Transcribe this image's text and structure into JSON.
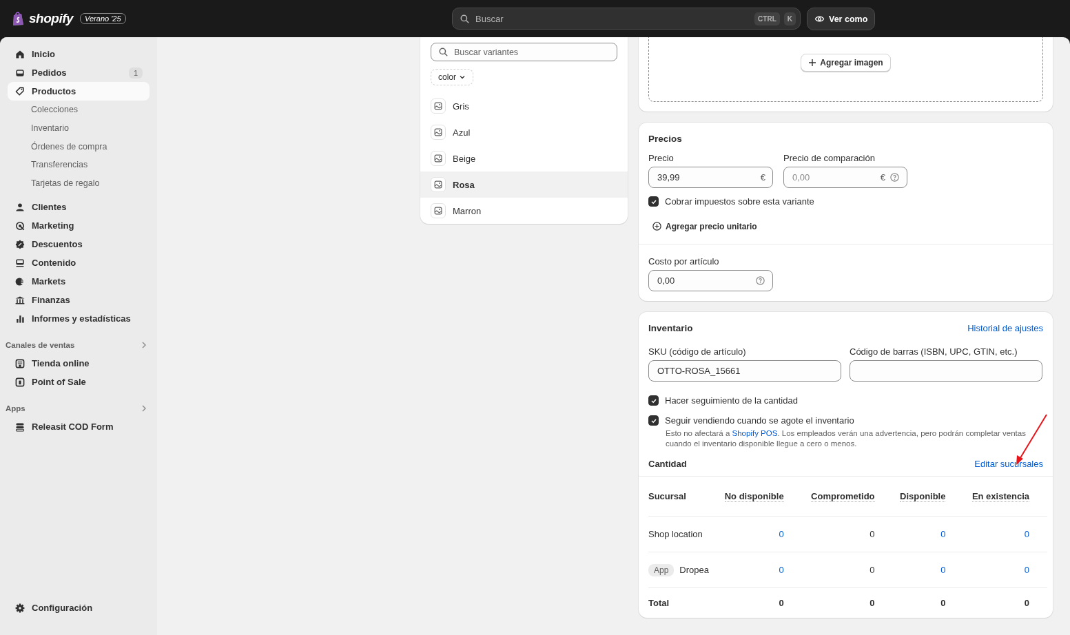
{
  "topbar": {
    "logo": "shopify",
    "edition": "Verano '25",
    "search": {
      "placeholder": "Buscar"
    },
    "shortcut": [
      "CTRL",
      "K"
    ],
    "view_button": "Ver como"
  },
  "sidebar": {
    "items": [
      {
        "label": "Inicio",
        "selected": false
      },
      {
        "label": "Pedidos",
        "selected": false,
        "badge": "1"
      },
      {
        "label": "Productos",
        "selected": true,
        "children": [
          {
            "label": "Colecciones",
            "selected": false
          },
          {
            "label": "Inventario",
            "selected": false
          },
          {
            "label": "Órdenes de compra",
            "selected": false
          },
          {
            "label": "Transferencias",
            "selected": false
          },
          {
            "label": "Tarjetas de regalo",
            "selected": false
          }
        ]
      },
      {
        "label": "Clientes",
        "selected": false
      },
      {
        "label": "Marketing",
        "selected": false
      },
      {
        "label": "Descuentos",
        "selected": false
      },
      {
        "label": "Contenido",
        "selected": false
      },
      {
        "label": "Markets",
        "selected": false
      },
      {
        "label": "Finanzas",
        "selected": false
      },
      {
        "label": "Informes y estadísticas",
        "selected": false
      }
    ],
    "sections": [
      {
        "title": "Canales de ventas",
        "items": [
          {
            "label": "Tienda online",
            "selected": false
          },
          {
            "label": "Point of Sale",
            "selected": false
          }
        ]
      },
      {
        "title": "Apps",
        "items": [
          {
            "label": "Releasit COD Form",
            "selected": false
          }
        ]
      }
    ],
    "footer": "Configuración"
  },
  "variants": {
    "search": {
      "placeholder": "Buscar variantes"
    },
    "filter": "color",
    "items": [
      {
        "name": "Gris",
        "selected": false
      },
      {
        "name": "Azul",
        "selected": false
      },
      {
        "name": "Beige",
        "selected": false
      },
      {
        "name": "Rosa",
        "selected": true
      },
      {
        "name": "Marron",
        "selected": false
      }
    ]
  },
  "media": {
    "add_button": "Agregar imagen"
  },
  "pricing": {
    "title": "Precios",
    "price": {
      "label": "Precio",
      "value": "39,99",
      "currency": "€"
    },
    "compare": {
      "label": "Precio de comparación",
      "placeholder": "0,00",
      "currency": "€"
    },
    "tax": {
      "label": "Cobrar impuestos sobre esta variante",
      "checked": true
    },
    "unit_price": "Agregar precio unitario",
    "cost": {
      "label": "Costo por artículo",
      "value": "0,00"
    }
  },
  "inventory": {
    "title": "Inventario",
    "history_link": "Historial de ajustes",
    "sku": {
      "label": "SKU (código de artículo)",
      "value": "OTTO-ROSA_15661"
    },
    "barcode": {
      "label": "Código de barras (ISBN, UPC, GTIN, etc.)"
    },
    "track": {
      "label": "Hacer seguimiento de la cantidad",
      "checked": true
    },
    "continue_selling": {
      "label": "Seguir vendiendo cuando se agote el inventario",
      "checked": true,
      "help_before": "Esto no afectará a ",
      "help_link": "Shopify POS",
      "help_after": ". Los empleados verán una advertencia, pero podrán completar ventas cuando el inventario disponible llegue a cero o menos."
    },
    "quantity_title": "Cantidad",
    "edit_link": "Editar sucursales",
    "table": {
      "columns": [
        "Sucursal",
        "No disponible",
        "Comprometido",
        "Disponible",
        "En existencia"
      ],
      "rows": [
        {
          "kind": "location",
          "cells": [
            {
              "value": "Shop location",
              "link": false
            },
            {
              "value": "0",
              "link": true
            },
            {
              "value": "0",
              "link": false
            },
            {
              "value": "0",
              "link": true
            },
            {
              "value": "0",
              "link": true
            }
          ]
        },
        {
          "kind": "location",
          "badge": "App",
          "cells": [
            {
              "value": "Dropea",
              "link": false
            },
            {
              "value": "0",
              "link": true
            },
            {
              "value": "0",
              "link": false
            },
            {
              "value": "0",
              "link": true
            },
            {
              "value": "0",
              "link": true
            }
          ]
        },
        {
          "kind": "total",
          "cells": [
            {
              "value": "Total",
              "link": false
            },
            {
              "value": "0",
              "link": false
            },
            {
              "value": "0",
              "link": false
            },
            {
              "value": "0",
              "link": false
            },
            {
              "value": "0",
              "link": false
            }
          ]
        }
      ]
    }
  }
}
